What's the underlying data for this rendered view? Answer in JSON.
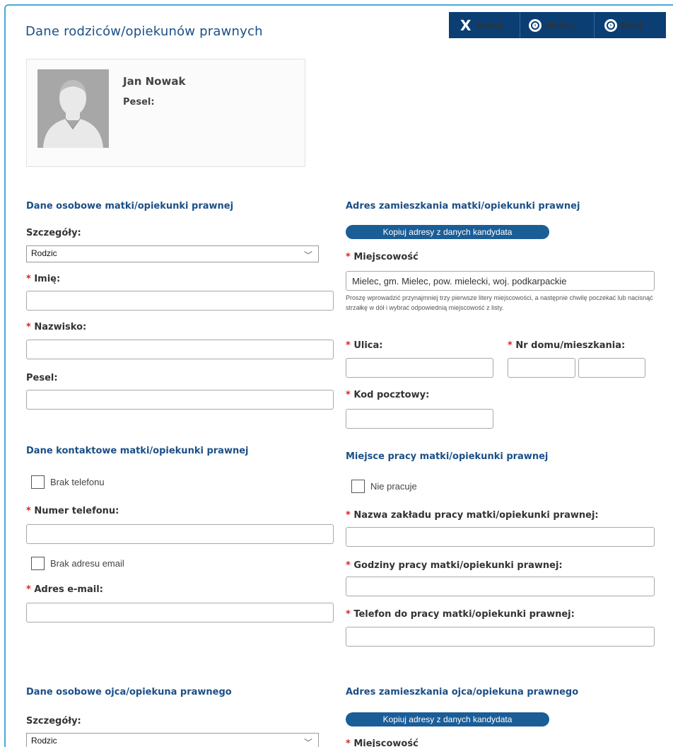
{
  "page": {
    "title": "Dane rodziców/opiekunów prawnych"
  },
  "toolbar": {
    "cancel_label": "Anuluj",
    "back_label": "Wstecz",
    "next_label": "Dalej"
  },
  "student": {
    "name": "Jan Nowak",
    "pesel_label": "Pesel:"
  },
  "mother_personal": {
    "heading": "Dane osobowe matki/opiekunki prawnej",
    "details_label": "Szczegóły:",
    "details_value": "Rodzic",
    "first_name_label": "Imię:",
    "last_name_label": "Nazwisko:",
    "pesel_label": "Pesel:"
  },
  "mother_address": {
    "heading": "Adres zamieszkania matki/opiekunki prawnej",
    "copy_button": "Kopiuj adresy z danych kandydata",
    "city_label": "Miejscowość",
    "city_value": "Mielec, gm. Mielec, pow. mielecki, woj. podkarpackie",
    "city_hint": "Proszę wprowadzić przynajmniej trzy pierwsze litery miejscowości, a następnie chwilę poczekać lub nacisnąć strzałkę w dół i wybrać odpowiednią miejscowość z listy.",
    "street_label": "Ulica:",
    "house_label": "Nr domu/mieszkania:",
    "postal_label": "Kod pocztowy:"
  },
  "mother_contact": {
    "heading": "Dane kontaktowe matki/opiekunki prawnej",
    "no_phone_label": "Brak telefonu",
    "phone_label": "Numer telefonu:",
    "no_email_label": "Brak adresu email",
    "email_label": "Adres e-mail:"
  },
  "mother_work": {
    "heading": "Miejsce pracy matki/opiekunki prawnej",
    "not_working_label": "Nie pracuje",
    "employer_label": "Nazwa zakładu pracy matki/opiekunki prawnej:",
    "hours_label": "Godziny pracy matki/opiekunki prawnej:",
    "work_phone_label": "Telefon do pracy matki/opiekunki prawnej:"
  },
  "father_personal": {
    "heading": "Dane osobowe ojca/opiekuna prawnego",
    "details_label": "Szczegóły:",
    "details_value": "Rodzic"
  },
  "father_address": {
    "heading": "Adres zamieszkania ojca/opiekuna prawnego",
    "copy_button": "Kopiuj adresy z danych kandydata",
    "city_label": "Miejscowość"
  },
  "required_mark": "*",
  "colors": {
    "brand": "#0b3e73",
    "heading": "#1b4f87",
    "required": "#d9251c",
    "frame": "#4aa8d8"
  },
  "icons": {
    "cancel": "close-x-icon",
    "back": "circle-arrow-left-icon",
    "next": "circle-arrow-right-icon",
    "select": "chevron-down-icon",
    "avatar": "user-silhouette-icon"
  }
}
